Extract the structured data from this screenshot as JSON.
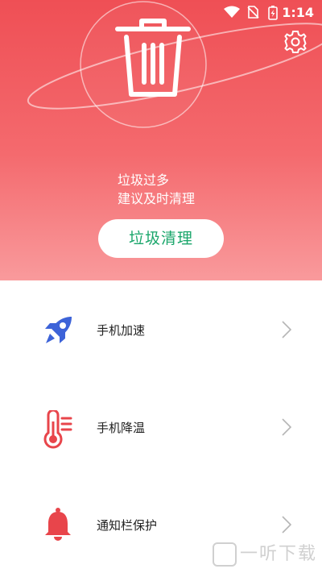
{
  "status_bar": {
    "time": "1:14"
  },
  "hero": {
    "message_line1": "垃圾过多",
    "message_line2": "建议及时清理",
    "clean_button_label": "垃圾清理",
    "icons": {
      "main": "trash-icon",
      "settings": "gear-icon"
    }
  },
  "menu": {
    "items": [
      {
        "label": "手机加速",
        "icon": "rocket-icon"
      },
      {
        "label": "手机降温",
        "icon": "thermometer-icon"
      },
      {
        "label": "通知栏保护",
        "icon": "bell-icon"
      }
    ]
  },
  "watermark": {
    "text": "一听下载"
  },
  "colors": {
    "hero_top": "#ef4f55",
    "hero_bottom": "#f99a9c",
    "accent_green": "#1aa66b",
    "rocket_blue": "#3d63d8"
  }
}
